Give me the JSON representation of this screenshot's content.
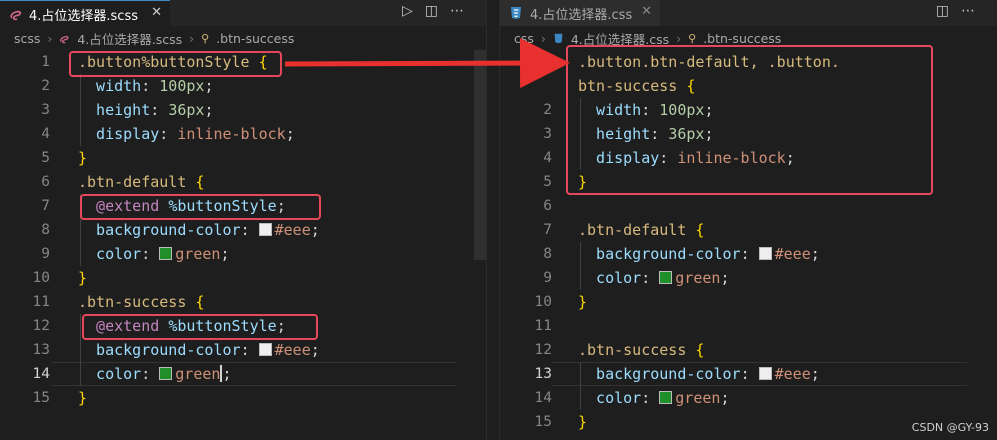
{
  "left": {
    "tab_label": "4.占位选择器.scss",
    "tab_close": "✕",
    "actions": [
      "▷",
      "◫",
      "⋯"
    ],
    "breadcrumb": [
      "scss",
      "4.占位选择器.scss",
      ".btn-success"
    ],
    "lines": [
      {
        "n": "1",
        "parts": [
          {
            "c": "sel",
            "t": ".button%buttonStyle "
          },
          {
            "c": "brace",
            "t": "{"
          }
        ]
      },
      {
        "n": "2",
        "parts": [
          {
            "c": "prop",
            "t": "  width"
          },
          {
            "c": "punc",
            "t": ": "
          },
          {
            "c": "num",
            "t": "100px"
          },
          {
            "c": "punc",
            "t": ";"
          }
        ]
      },
      {
        "n": "3",
        "parts": [
          {
            "c": "prop",
            "t": "  height"
          },
          {
            "c": "punc",
            "t": ": "
          },
          {
            "c": "num",
            "t": "36px"
          },
          {
            "c": "punc",
            "t": ";"
          }
        ]
      },
      {
        "n": "4",
        "parts": [
          {
            "c": "prop",
            "t": "  display"
          },
          {
            "c": "punc",
            "t": ": "
          },
          {
            "c": "val",
            "t": "inline-block"
          },
          {
            "c": "punc",
            "t": ";"
          }
        ]
      },
      {
        "n": "5",
        "parts": [
          {
            "c": "brace",
            "t": "}"
          }
        ]
      },
      {
        "n": "6",
        "parts": [
          {
            "c": "sel",
            "t": ".btn-default "
          },
          {
            "c": "brace",
            "t": "{"
          }
        ]
      },
      {
        "n": "7",
        "parts": [
          {
            "c": "at",
            "t": "  @extend "
          },
          {
            "c": "ph",
            "t": "%buttonStyle"
          },
          {
            "c": "punc",
            "t": ";"
          }
        ]
      },
      {
        "n": "8",
        "parts": [
          {
            "c": "prop",
            "t": "  background-color"
          },
          {
            "c": "punc",
            "t": ": "
          },
          {
            "c": "swatch",
            "t": "#eeeeee"
          },
          {
            "c": "val",
            "t": "#eee"
          },
          {
            "c": "punc",
            "t": ";"
          }
        ]
      },
      {
        "n": "9",
        "parts": [
          {
            "c": "prop",
            "t": "  color"
          },
          {
            "c": "punc",
            "t": ": "
          },
          {
            "c": "swatch",
            "t": "#1f8f2a"
          },
          {
            "c": "val",
            "t": "green"
          },
          {
            "c": "punc",
            "t": ";"
          }
        ]
      },
      {
        "n": "10",
        "parts": [
          {
            "c": "brace",
            "t": "}"
          }
        ]
      },
      {
        "n": "11",
        "parts": [
          {
            "c": "sel",
            "t": ".btn-success "
          },
          {
            "c": "brace",
            "t": "{"
          }
        ]
      },
      {
        "n": "12",
        "parts": [
          {
            "c": "at",
            "t": "  @extend "
          },
          {
            "c": "ph",
            "t": "%buttonStyle"
          },
          {
            "c": "punc",
            "t": ";"
          }
        ]
      },
      {
        "n": "13",
        "parts": [
          {
            "c": "prop",
            "t": "  background-color"
          },
          {
            "c": "punc",
            "t": ": "
          },
          {
            "c": "swatch",
            "t": "#eeeeee"
          },
          {
            "c": "val",
            "t": "#eee"
          },
          {
            "c": "punc",
            "t": ";"
          }
        ]
      },
      {
        "n": "14",
        "parts": [
          {
            "c": "prop",
            "t": "  color"
          },
          {
            "c": "punc",
            "t": ": "
          },
          {
            "c": "swatch",
            "t": "#1f8f2a"
          },
          {
            "c": "val",
            "t": "green"
          },
          {
            "c": "cursor",
            "t": ""
          },
          {
            "c": "punc",
            "t": ";"
          }
        ]
      },
      {
        "n": "15",
        "parts": [
          {
            "c": "brace",
            "t": "}"
          }
        ]
      }
    ],
    "active_line": "14"
  },
  "right": {
    "tab_label": "4.占位选择器.css",
    "tab_close": "✕",
    "actions": [
      "◫",
      "⋯"
    ],
    "breadcrumb": [
      "css",
      "4.占位选择器.css",
      ".btn-success"
    ],
    "lines": [
      {
        "n": "",
        "parts": [
          {
            "c": "sel",
            "t": ".button.btn-default, .button."
          }
        ]
      },
      {
        "n": "",
        "parts": [
          {
            "c": "sel",
            "t": "btn-success "
          },
          {
            "c": "brace",
            "t": "{"
          }
        ]
      },
      {
        "n": "2",
        "parts": [
          {
            "c": "prop",
            "t": "  width"
          },
          {
            "c": "punc",
            "t": ": "
          },
          {
            "c": "num",
            "t": "100px"
          },
          {
            "c": "punc",
            "t": ";"
          }
        ]
      },
      {
        "n": "3",
        "parts": [
          {
            "c": "prop",
            "t": "  height"
          },
          {
            "c": "punc",
            "t": ": "
          },
          {
            "c": "num",
            "t": "36px"
          },
          {
            "c": "punc",
            "t": ";"
          }
        ]
      },
      {
        "n": "4",
        "parts": [
          {
            "c": "prop",
            "t": "  display"
          },
          {
            "c": "punc",
            "t": ": "
          },
          {
            "c": "val",
            "t": "inline-block"
          },
          {
            "c": "punc",
            "t": ";"
          }
        ]
      },
      {
        "n": "5",
        "parts": [
          {
            "c": "brace",
            "t": "}"
          }
        ]
      },
      {
        "n": "6",
        "parts": []
      },
      {
        "n": "7",
        "parts": [
          {
            "c": "sel",
            "t": ".btn-default "
          },
          {
            "c": "brace",
            "t": "{"
          }
        ]
      },
      {
        "n": "8",
        "parts": [
          {
            "c": "prop",
            "t": "  background-color"
          },
          {
            "c": "punc",
            "t": ": "
          },
          {
            "c": "swatch",
            "t": "#eeeeee"
          },
          {
            "c": "val",
            "t": "#eee"
          },
          {
            "c": "punc",
            "t": ";"
          }
        ]
      },
      {
        "n": "9",
        "parts": [
          {
            "c": "prop",
            "t": "  color"
          },
          {
            "c": "punc",
            "t": ": "
          },
          {
            "c": "swatch",
            "t": "#1f8f2a"
          },
          {
            "c": "val",
            "t": "green"
          },
          {
            "c": "punc",
            "t": ";"
          }
        ]
      },
      {
        "n": "10",
        "parts": [
          {
            "c": "brace",
            "t": "}"
          }
        ]
      },
      {
        "n": "11",
        "parts": []
      },
      {
        "n": "12",
        "parts": [
          {
            "c": "sel",
            "t": ".btn-success "
          },
          {
            "c": "brace",
            "t": "{"
          }
        ]
      },
      {
        "n": "13",
        "parts": [
          {
            "c": "prop",
            "t": "  background-color"
          },
          {
            "c": "punc",
            "t": ": "
          },
          {
            "c": "swatch",
            "t": "#eeeeee"
          },
          {
            "c": "val",
            "t": "#eee"
          },
          {
            "c": "punc",
            "t": ";"
          }
        ]
      },
      {
        "n": "14",
        "parts": [
          {
            "c": "prop",
            "t": "  color"
          },
          {
            "c": "punc",
            "t": ": "
          },
          {
            "c": "swatch",
            "t": "#1f8f2a"
          },
          {
            "c": "val",
            "t": "green"
          },
          {
            "c": "punc",
            "t": ";"
          }
        ]
      },
      {
        "n": "15",
        "parts": [
          {
            "c": "brace",
            "t": "}"
          }
        ]
      }
    ],
    "active_line": "13"
  },
  "watermark": "CSDN @GY-93",
  "colors": {
    "highlight": "#e5485b",
    "arrow": "#e8302f",
    "scss_icon": "#d46a8f",
    "css_icon": "#3b88c3"
  }
}
